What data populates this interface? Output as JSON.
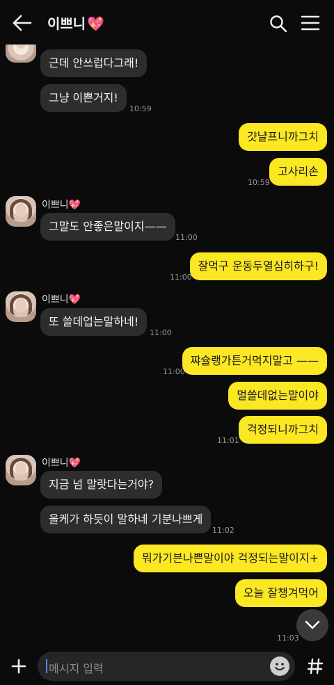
{
  "header": {
    "title": "이쁘니",
    "title_emoji": "💖"
  },
  "messages": [
    {
      "text": "근데 안쓰럽다그래!"
    },
    {
      "text": "그냥 이쁜거지!",
      "time": "10:59"
    },
    {
      "text": "걋냘프니까그치"
    },
    {
      "text": "고사리손",
      "time": "10:59"
    },
    {
      "sender": "이쁘니",
      "sender_emoji": "💖",
      "text": "그말도 안좋은말이지——",
      "time": "11:00"
    },
    {
      "text": "잘먹구 운동두열심히하구!",
      "time": "11:00"
    },
    {
      "sender": "이쁘니",
      "sender_emoji": "💖",
      "text": "또 쓸데업는말하네!",
      "time": "11:00"
    },
    {
      "text": "쨔슐랭가튼거먹지말고 ——",
      "time": "11:00"
    },
    {
      "text": "멀쓸데없는말이야"
    },
    {
      "text": "걱정되니까그치",
      "time": "11:01"
    },
    {
      "sender": "이쁘니",
      "sender_emoji": "💖",
      "text": "지금 넘 말랏다는거야?"
    },
    {
      "text": "올케가 하듯이 말하네 기분나쁘게",
      "time": "11:02"
    },
    {
      "text": "뭐가기븐나쁜말이야 걱정되는말이지+"
    },
    {
      "text": "오늘 잘챙겨먹어",
      "time": "11:03"
    }
  ],
  "input": {
    "placeholder": "메시지 입력"
  },
  "icons": {
    "back": "arrow-left-icon",
    "search": "search-icon",
    "menu": "hamburger-menu-icon",
    "plus": "plus-icon",
    "emoji": "emoji-icon",
    "hash": "hashtag-icon",
    "scroll": "chevron-down-icon"
  },
  "colors": {
    "background": "#0b0b0b",
    "incoming_bubble": "#2d2d2d",
    "outgoing_bubble": "#fce723",
    "accent_heart": "#ff5fb4"
  }
}
